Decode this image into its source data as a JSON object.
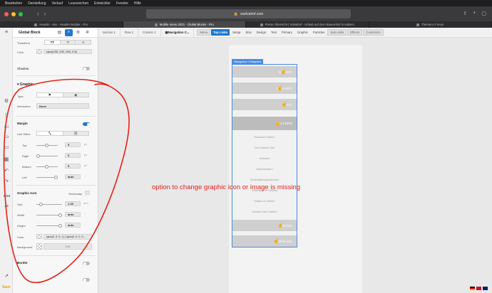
{
  "menubar": {
    "items": [
      "Bearbeiten",
      "Darstellung",
      "Verlauf",
      "Lesezeichen",
      "Entwickler",
      "Fenster",
      "Hilfe"
    ]
  },
  "browser": {
    "url": "soelvahof.com",
    "tabs": [
      {
        "label": "Header - dev - Header Builder - Pro",
        "active": false
      },
      {
        "label": "Mobile menu 2021 - Global Blocks - Pro",
        "active": true
      },
      {
        "label": "Preise Übersicht | Sölvahof - Urlaub auf dem Bauernhof in Kaltern",
        "active": false
      },
      {
        "label": "Themeco Forum",
        "active": false
      }
    ]
  },
  "panel": {
    "title": "Global Block",
    "transform_label": "Transform",
    "transform_options": [
      "TT",
      "Tt",
      "tt"
    ],
    "color_label": "Color",
    "color_value": "rgba(255, 255, 255, 0.8)",
    "shadow_label": "Shadow",
    "graphic_section": "Graphic",
    "type_label": "Type",
    "type_options": [
      "icon",
      "image"
    ],
    "interaction_label": "Interaction",
    "interaction_value": "None",
    "margin_section": "Margin",
    "link_sides_label": "Link Sides",
    "sides": [
      {
        "label": "Top",
        "value": "5",
        "unit": "px"
      },
      {
        "label": "Right",
        "value": "0",
        "unit": "px"
      },
      {
        "label": "Bottom",
        "value": "5",
        "unit": "px"
      },
      {
        "label": "Left",
        "value": "auto",
        "unit": "..."
      }
    ],
    "graphic_icon_section": "Graphic Icon",
    "secondary_label": "Secondary",
    "icon_fields": [
      {
        "label": "Size",
        "value": "1.25",
        "unit": "rem"
      },
      {
        "label": "Width",
        "value": "auto",
        "unit": "..."
      },
      {
        "label": "Height",
        "value": "auto",
        "unit": "..."
      }
    ],
    "icon_color_label": "Color",
    "icon_color_value": "rgba(0, 0, 0, 1) | rgba(0, 0, 0, 0...",
    "background_label": "Background",
    "background_value": "Edit",
    "border_section": "Border",
    "rail_css": "CSS",
    "rail_js": "JS",
    "save_label": "Save"
  },
  "editor": {
    "crumbs": [
      "Section 1",
      "Row 1",
      "Column 1",
      "Navigation C..."
    ],
    "tabs": [
      {
        "label": "Menu",
        "style": "box"
      },
      {
        "label": "Top Links",
        "style": "hl"
      },
      {
        "label": "Setup",
        "style": ""
      },
      {
        "label": "Size",
        "style": ""
      },
      {
        "label": "Design",
        "style": ""
      },
      {
        "label": "Text",
        "style": ""
      },
      {
        "label": "Primary",
        "style": ""
      },
      {
        "label": "Graphic",
        "style": ""
      },
      {
        "label": "Particles",
        "style": ""
      },
      {
        "label": "Sub Links",
        "style": "box"
      },
      {
        "label": "Effects",
        "style": "box"
      },
      {
        "label": "Customize",
        "style": "box"
      }
    ]
  },
  "canvas": {
    "badge": "Navigation Collapsed",
    "nav_items": [
      "ER HOF",
      "WOHNEN",
      "AKTIV",
      "KALTERN"
    ],
    "sub_items": [
      "Reisedorf Kaltern",
      "Der Kalterer See",
      "Kulinarik",
      "Weinwandern",
      "Veranstaltungskalender",
      "Unterwegs in Südtirol",
      "Kaltern im Winter",
      "Anreise nach Kaltern"
    ],
    "nav_items_bottom": [
      "PREISE",
      "ANFRAGE"
    ]
  },
  "annotation": {
    "text": "option to change graphic icon or image is missing"
  },
  "colors": {
    "accent": "#1e78d2",
    "annotation": "#e2231a",
    "selection": "#4a8be0"
  }
}
